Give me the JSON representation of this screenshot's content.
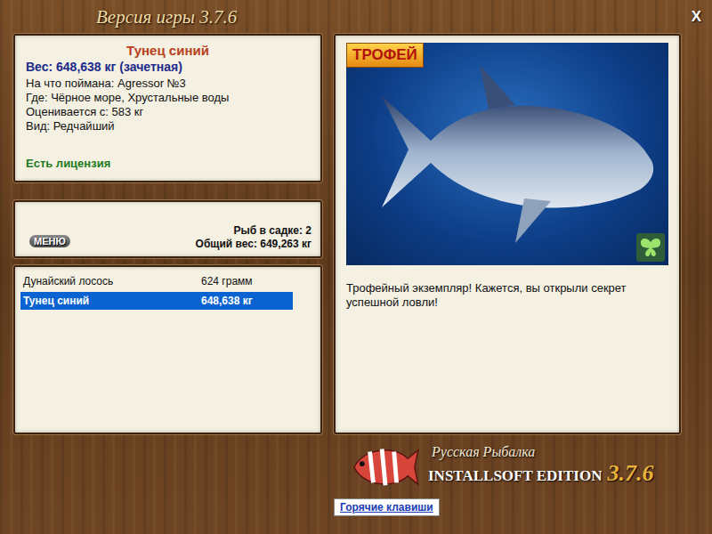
{
  "window": {
    "title": "Версия игры 3.7.6",
    "close": "X"
  },
  "fish_card": {
    "name": "Тунец синий",
    "weight": "Вес: 648,638 кг (зачетная)",
    "details": [
      "На что поймана: Agressor №3",
      "Где: Чёрное море, Хрустальные воды",
      "Оценивается с: 583 кг",
      "Вид: Редчайший"
    ],
    "license": "Есть лицензия"
  },
  "cage": {
    "menu_button": "МЕНЮ",
    "count": "Рыб в садке: 2",
    "total": "Общий вес: 649,263 кг"
  },
  "catch_list": [
    {
      "name": "Дунайский лосось",
      "weight": "624 грамм",
      "selected": false
    },
    {
      "name": "Тунец синий",
      "weight": "648,638 кг",
      "selected": true
    }
  ],
  "photo": {
    "badge": "ТРОФЕЙ"
  },
  "message": "Трофейный экземпляр! Кажется, вы открыли секрет успешной ловли!",
  "brand": {
    "title": "Русская Рыбалка",
    "edition": "INSTALLSOFT EDITION",
    "version": "3.7.6"
  },
  "hotkeys_link": "Горячие клавиши"
}
